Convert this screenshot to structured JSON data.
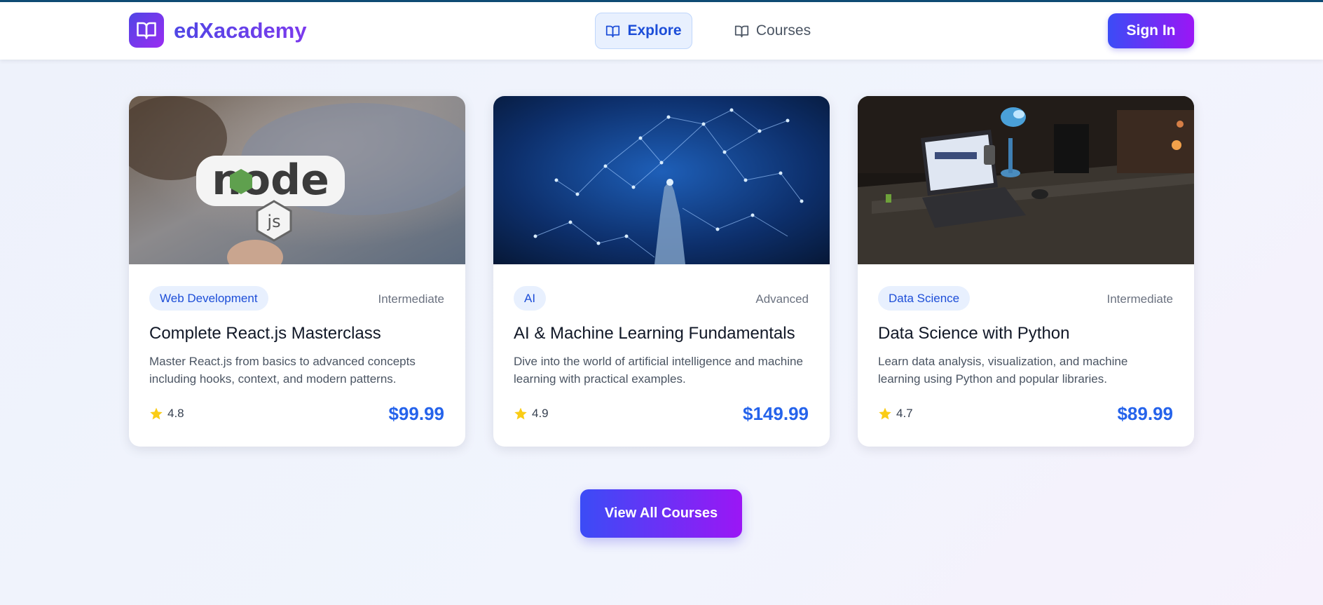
{
  "header": {
    "brand": "edXacademy",
    "nav": [
      {
        "label": "Explore",
        "icon": "book-open-icon",
        "active": true
      },
      {
        "label": "Courses",
        "icon": "book-open-icon",
        "active": false
      }
    ],
    "sign_in_label": "Sign In"
  },
  "courses": [
    {
      "image": "nodejs-sticker-photo",
      "category": "Web Development",
      "level": "Intermediate",
      "title": "Complete React.js Masterclass",
      "description": "Master React.js from basics to advanced concepts including hooks, context, and modern patterns.",
      "rating": "4.8",
      "price": "$99.99"
    },
    {
      "image": "neural-network-robot-hand-photo",
      "category": "AI",
      "level": "Advanced",
      "title": "AI & Machine Learning Fundamentals",
      "description": "Dive into the world of artificial intelligence and machine learning with practical examples.",
      "rating": "4.9",
      "price": "$149.99"
    },
    {
      "image": "laptop-desk-photo",
      "category": "Data Science",
      "level": "Intermediate",
      "title": "Data Science with Python",
      "description": "Learn data analysis, visualization, and machine learning using Python and popular libraries.",
      "rating": "4.7",
      "price": "$89.99"
    }
  ],
  "view_all_label": "View All Courses",
  "colors": {
    "accent_blue": "#2563eb",
    "gradient_start": "#3b4cf6",
    "gradient_end": "#9b16f5",
    "star": "#facc15",
    "badge_bg": "#e8f0fe"
  }
}
